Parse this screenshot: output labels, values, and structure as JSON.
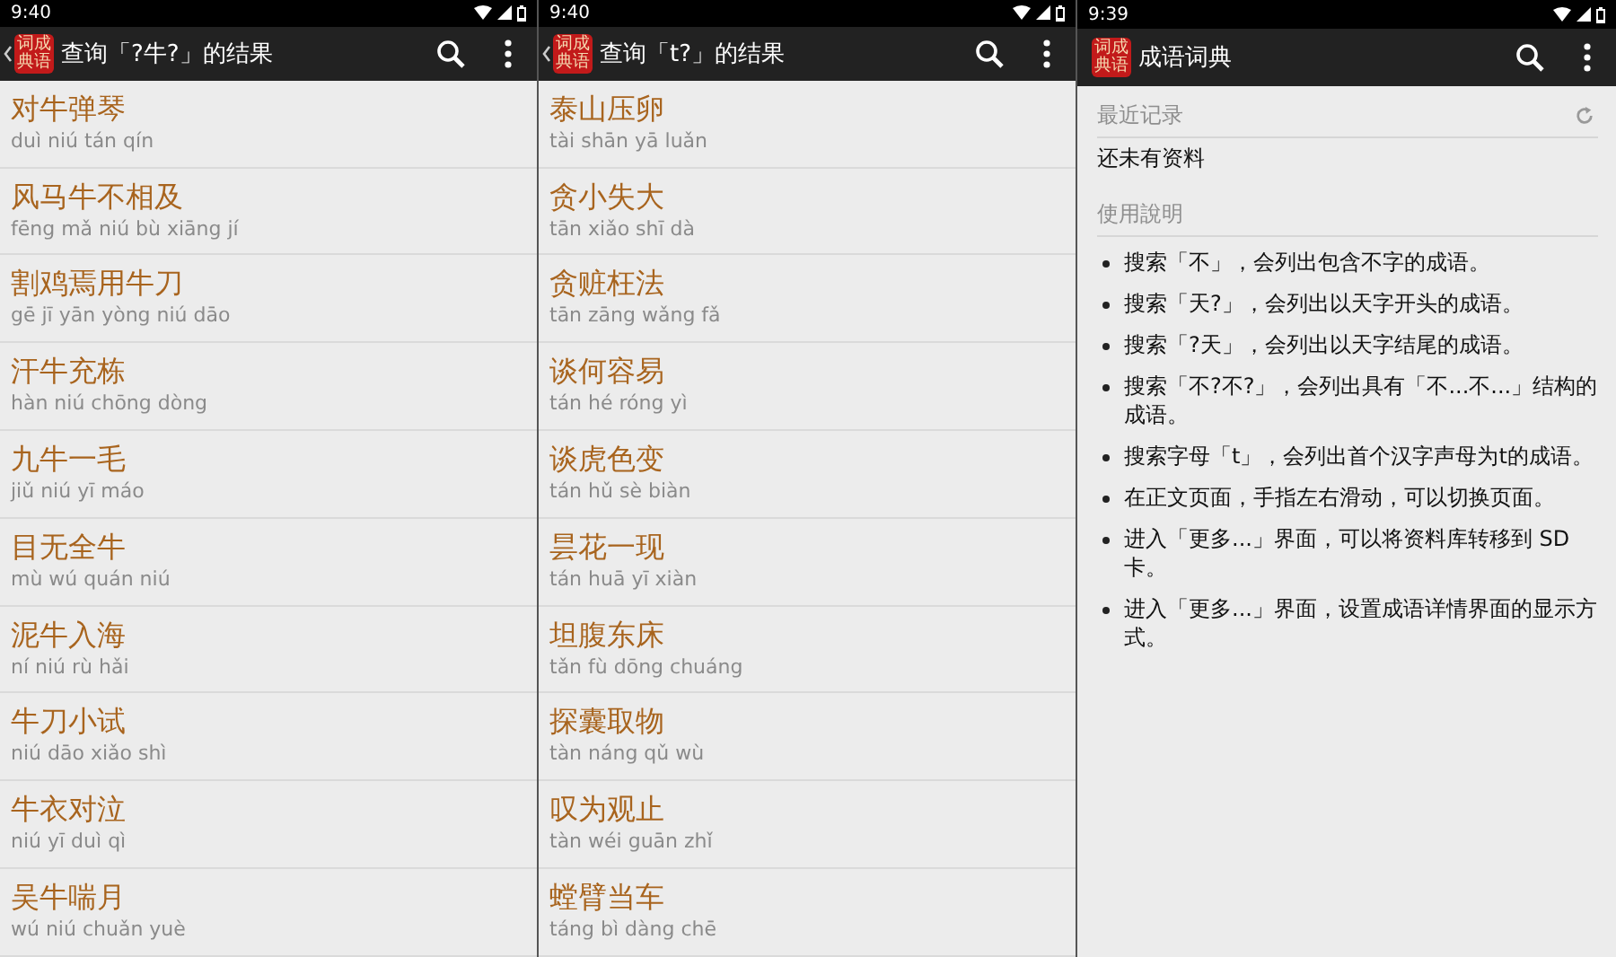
{
  "screens": [
    {
      "kind": "results",
      "status_time": "9:40",
      "app_bar": {
        "back": true,
        "logo_lines": [
          "词成",
          "典语"
        ],
        "title": "查询「?牛?」的结果"
      },
      "results": [
        {
          "idiom": "对牛弹琴",
          "pinyin": "duì niú tán qín"
        },
        {
          "idiom": "风马牛不相及",
          "pinyin": "fēng mǎ niú bù xiāng jí"
        },
        {
          "idiom": "割鸡焉用牛刀",
          "pinyin": "gē jī yān yòng niú dāo"
        },
        {
          "idiom": "汗牛充栋",
          "pinyin": "hàn niú chōng dòng"
        },
        {
          "idiom": "九牛一毛",
          "pinyin": "jiǔ niú yī máo"
        },
        {
          "idiom": "目无全牛",
          "pinyin": "mù wú quán niú"
        },
        {
          "idiom": "泥牛入海",
          "pinyin": "ní niú rù hǎi"
        },
        {
          "idiom": "牛刀小试",
          "pinyin": "niú dāo xiǎo shì"
        },
        {
          "idiom": "牛衣对泣",
          "pinyin": "niú yī duì qì"
        },
        {
          "idiom": "吴牛喘月",
          "pinyin": "wú niú chuǎn yuè"
        }
      ]
    },
    {
      "kind": "results",
      "status_time": "9:40",
      "app_bar": {
        "back": true,
        "logo_lines": [
          "词成",
          "典语"
        ],
        "title": "查询「t?」的结果"
      },
      "results": [
        {
          "idiom": "泰山压卵",
          "pinyin": "tài shān yā luǎn"
        },
        {
          "idiom": "贪小失大",
          "pinyin": "tān xiǎo shī dà"
        },
        {
          "idiom": "贪赃枉法",
          "pinyin": "tān zāng wǎng fǎ"
        },
        {
          "idiom": "谈何容易",
          "pinyin": "tán hé róng yì"
        },
        {
          "idiom": "谈虎色变",
          "pinyin": "tán hǔ sè biàn"
        },
        {
          "idiom": "昙花一现",
          "pinyin": "tán huā yī xiàn"
        },
        {
          "idiom": "坦腹东床",
          "pinyin": "tǎn fù dōng chuáng"
        },
        {
          "idiom": "探囊取物",
          "pinyin": "tàn náng qǔ wù"
        },
        {
          "idiom": "叹为观止",
          "pinyin": "tàn wéi guān zhǐ"
        },
        {
          "idiom": "螳臂当车",
          "pinyin": "táng bì dàng chē"
        }
      ]
    },
    {
      "kind": "home",
      "status_time": "9:39",
      "app_bar": {
        "back": false,
        "logo_lines": [
          "词成",
          "典语"
        ],
        "title": "成语词典"
      },
      "recent": {
        "heading": "最近记录",
        "empty_text": "还未有资料"
      },
      "help": {
        "heading": "使用說明",
        "tips": [
          "搜索「不」，会列出包含不字的成语。",
          "搜索「天?」，会列出以天字开头的成语。",
          "搜索「?天」，会列出以天字结尾的成语。",
          "搜索「不?不?」，会列出具有「不...不...」结构的成语。",
          "搜索字母「t」，会列出首个汉字声母为t的成语。",
          "在正文页面，手指左右滑动，可以切换页面。",
          "进入「更多...」界面，可以将资料库转移到 SD 卡。",
          "进入「更多...」界面，设置成语详情界面的显示方式。"
        ]
      }
    }
  ]
}
